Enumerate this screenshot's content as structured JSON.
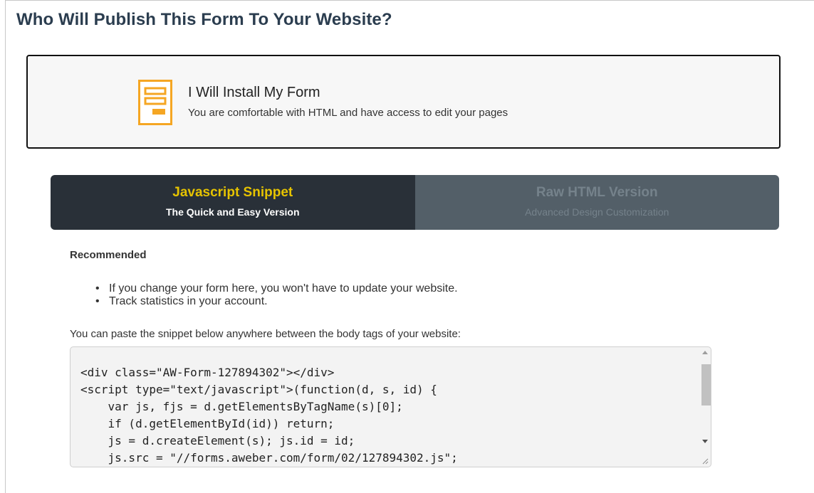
{
  "page": {
    "title": "Who Will Publish This Form To Your Website?"
  },
  "option": {
    "title": "I Will Install My Form",
    "subtitle": "You are comfortable with HTML and have access to edit your pages",
    "icon": "form-icon",
    "accent_color": "#f5a623"
  },
  "tabs": [
    {
      "title": "Javascript Snippet",
      "subtitle": "The Quick and Easy Version",
      "active": true
    },
    {
      "title": "Raw HTML Version",
      "subtitle": "Advanced Design Customization",
      "active": false
    }
  ],
  "content": {
    "recommended": "Recommended",
    "bullets": [
      "If you change your form here, you won't have to update your website.",
      "Track statistics in your account."
    ],
    "paste_label": "You can paste the snippet below anywhere between the body tags of your website:",
    "code": "<div class=\"AW-Form-127894302\"></div>\n<script type=\"text/javascript\">(function(d, s, id) {\n    var js, fjs = d.getElementsByTagName(s)[0];\n    if (d.getElementById(id)) return;\n    js = d.createElement(s); js.id = id;\n    js.src = \"//forms.aweber.com/form/02/127894302.js\";"
  }
}
